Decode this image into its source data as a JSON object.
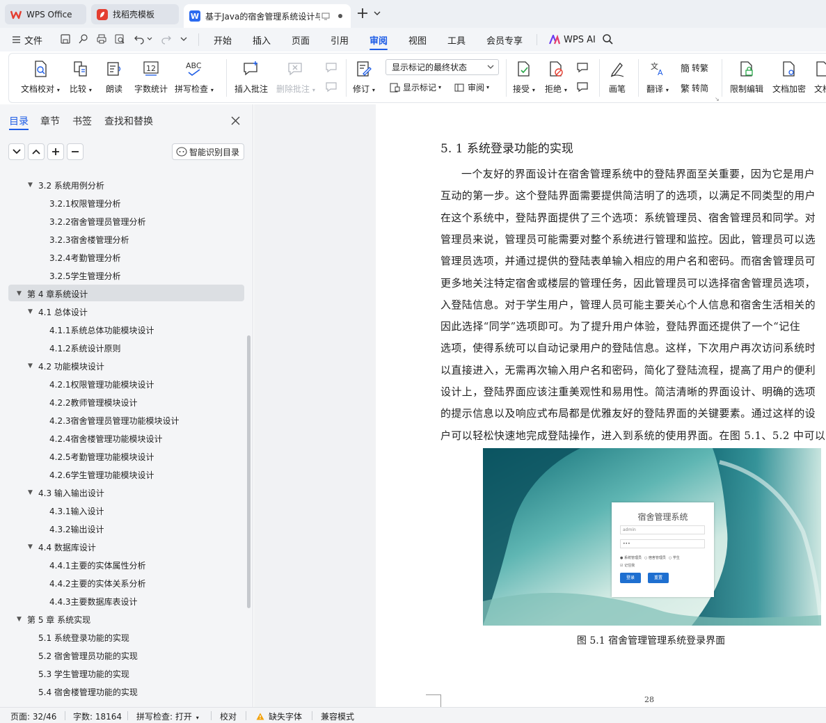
{
  "tabs": [
    {
      "label": "WPS Office",
      "icon": "wps-logo-icon"
    },
    {
      "label": "找稻壳模板",
      "icon": "docer-icon"
    },
    {
      "label": "基于Java的宿舍管理系统设计与",
      "icon": "word-doc-icon"
    }
  ],
  "menubar": {
    "file": "文件",
    "items": [
      "开始",
      "插入",
      "页面",
      "引用",
      "审阅",
      "视图",
      "工具",
      "会员专享"
    ],
    "active": "审阅",
    "wps_ai": "WPS AI"
  },
  "ribbon": {
    "doc_check": "文档校对",
    "compare": "比较",
    "read_aloud": "朗读",
    "word_count": "字数统计",
    "spell_check": "拼写检查",
    "insert_comment": "插入批注",
    "delete_comment": "删除批注",
    "revise": "修订",
    "show_mode": "显示标记的最终状态",
    "show_marks": "显示标记",
    "review": "审阅",
    "accept": "接受",
    "reject": "拒绝",
    "pen": "画笔",
    "translate": "翻译",
    "to_traditional": "转繁",
    "to_simplified": "转简",
    "restrict_edit": "限制编辑",
    "encrypt": "文档加密",
    "more": "文档",
    "word_count_icon_text": "12",
    "spell_icon_text": "ABC"
  },
  "panel": {
    "tabs": [
      "目录",
      "章节",
      "书签",
      "查找和替换"
    ],
    "smart_toc": "智能识别目录",
    "toc": [
      {
        "label": "3.2 系统用例分析",
        "level": 1,
        "arrow": true
      },
      {
        "label": "3.2.1权限管理分析",
        "level": 2
      },
      {
        "label": "3.2.2宿舍管理员管理分析",
        "level": 2
      },
      {
        "label": "3.2.3宿舍楼管理分析",
        "level": 2
      },
      {
        "label": "3.2.4考勤管理分析",
        "level": 2
      },
      {
        "label": "3.2.5学生管理分析",
        "level": 2
      },
      {
        "label": "第 4 章系统设计",
        "level": 0,
        "arrow": true,
        "selected": true
      },
      {
        "label": "4.1 总体设计",
        "level": 1,
        "arrow": true
      },
      {
        "label": "4.1.1系统总体功能模块设计",
        "level": 2
      },
      {
        "label": "4.1.2系统设计原则",
        "level": 2
      },
      {
        "label": "4.2 功能模块设计",
        "level": 1,
        "arrow": true
      },
      {
        "label": "4.2.1权限管理功能模块设计",
        "level": 2
      },
      {
        "label": "4.2.2教师管理模块设计",
        "level": 2
      },
      {
        "label": "4.2.3宿舍管理员管理功能模块设计",
        "level": 2
      },
      {
        "label": "4.2.4宿舍楼管理功能模块设计",
        "level": 2
      },
      {
        "label": "4.2.5考勤管理功能模块设计",
        "level": 2
      },
      {
        "label": "4.2.6学生管理功能模块设计",
        "level": 2
      },
      {
        "label": "4.3 输入输出设计",
        "level": 1,
        "arrow": true
      },
      {
        "label": "4.3.1输入设计",
        "level": 2
      },
      {
        "label": "4.3.2输出设计",
        "level": 2
      },
      {
        "label": "4.4 数据库设计",
        "level": 1,
        "arrow": true
      },
      {
        "label": "4.4.1主要的实体属性分析",
        "level": 2
      },
      {
        "label": "4.4.2主要的实体关系分析",
        "level": 2
      },
      {
        "label": "4.4.3主要数据库表设计",
        "level": 2
      },
      {
        "label": "第 5 章 系统实现",
        "level": 0,
        "arrow": true
      },
      {
        "label": "5.1 系统登录功能的实现",
        "level": 1
      },
      {
        "label": "5.2 宿舍管理员功能的实现",
        "level": 1
      },
      {
        "label": "5.3 学生管理功能的实现",
        "level": 1
      },
      {
        "label": "5.4 宿舍楼管理功能的实现",
        "level": 1
      }
    ]
  },
  "doc": {
    "heading": "5. 1 系统登录功能的实现",
    "lines": [
      "一个友好的界面设计在宿舍管理系统中的登陆界面至关重要，因为它是用户",
      "互动的第一步。这个登陆界面需要提供简洁明了的选项，以满足不同类型的用户",
      "在这个系统中，登陆界面提供了三个选项：系统管理员、宿舍管理员和同学。对",
      "管理员来说，管理员可能需要对整个系统进行管理和监控。因此，管理员可以选",
      "管理员选项，并通过提供的登陆表单输入相应的用户名和密码。而宿舍管理员可",
      "更多地关注特定宿舍或楼层的管理任务，因此管理员可以选择宿舍管理员选项，",
      "入登陆信息。对于学生用户，管理人员可能主要关心个人信息和宿舍生活相关的",
      "因此选择“同学”选项即可。为了提升用户体验，登陆界面还提供了一个“记住",
      "选项，使得系统可以自动记录用户的登陆信息。这样，下次用户再次访问系统时",
      "以直接进入，无需再次输入用户名和密码，简化了登陆流程，提高了用户的便利",
      "设计上，登陆界面应该注重美观性和易用性。简洁清晰的界面设计、明确的选项",
      "的提示信息以及响应式布局都是优雅友好的登陆界面的关键要素。通过这样的设",
      "户可以轻松快速地完成登陆操作，进入到系统的使用界面。在图 5.1、5.2 中可以"
    ],
    "figure": {
      "login_title": "宿舍管理系统",
      "username": "admin",
      "password": "•••",
      "roles": [
        "系统管理员",
        "宿舍管理员",
        "学生"
      ],
      "remember": "记住我",
      "login_btn": "登录",
      "reset_btn": "重置"
    },
    "caption": "图 5.1 宿舍管理管理系统登录界面",
    "page_number": "28"
  },
  "status": {
    "page": "页面: 32/46",
    "words": "字数: 18164",
    "spell": "拼写检查: 打开",
    "proof": "校对",
    "missing_font": "缺失字体",
    "compat": "兼容模式"
  },
  "colors": {
    "accent": "#1d5ce6",
    "wps_red": "#e43e31"
  }
}
